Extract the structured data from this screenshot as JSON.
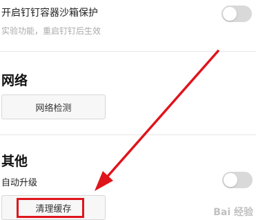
{
  "sandbox": {
    "title": "开启钉钉容器沙箱保护",
    "description": "实验功能，重启钉钉后生效",
    "toggle_on": false
  },
  "network": {
    "heading": "网络",
    "check_button": "网络检测"
  },
  "other": {
    "heading": "其他",
    "auto_update_label": "自动升级",
    "auto_update_on": false,
    "clear_cache_button": "清理缓存"
  },
  "watermark": {
    "text": "Bai 经验"
  },
  "colors": {
    "annotation_red": "#e0141b",
    "toggle_off": "#d9d9d9"
  }
}
